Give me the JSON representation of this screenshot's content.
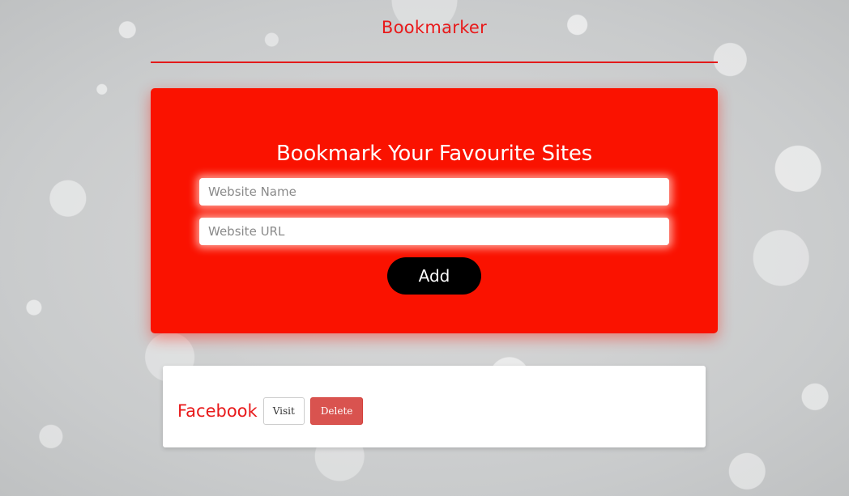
{
  "header": {
    "title": "Bookmarker"
  },
  "form": {
    "heading": "Bookmark Your Favourite Sites",
    "name_field": {
      "placeholder": "Website Name",
      "value": ""
    },
    "url_field": {
      "placeholder": "Website URL",
      "value": ""
    },
    "add_label": "Add"
  },
  "bookmarks": [
    {
      "name": "Facebook",
      "visit_label": "Visit",
      "delete_label": "Delete"
    }
  ],
  "colors": {
    "accent": "#e8191a",
    "card_red": "#fa1200",
    "delete": "#d9534f",
    "add_button": "#000000"
  }
}
